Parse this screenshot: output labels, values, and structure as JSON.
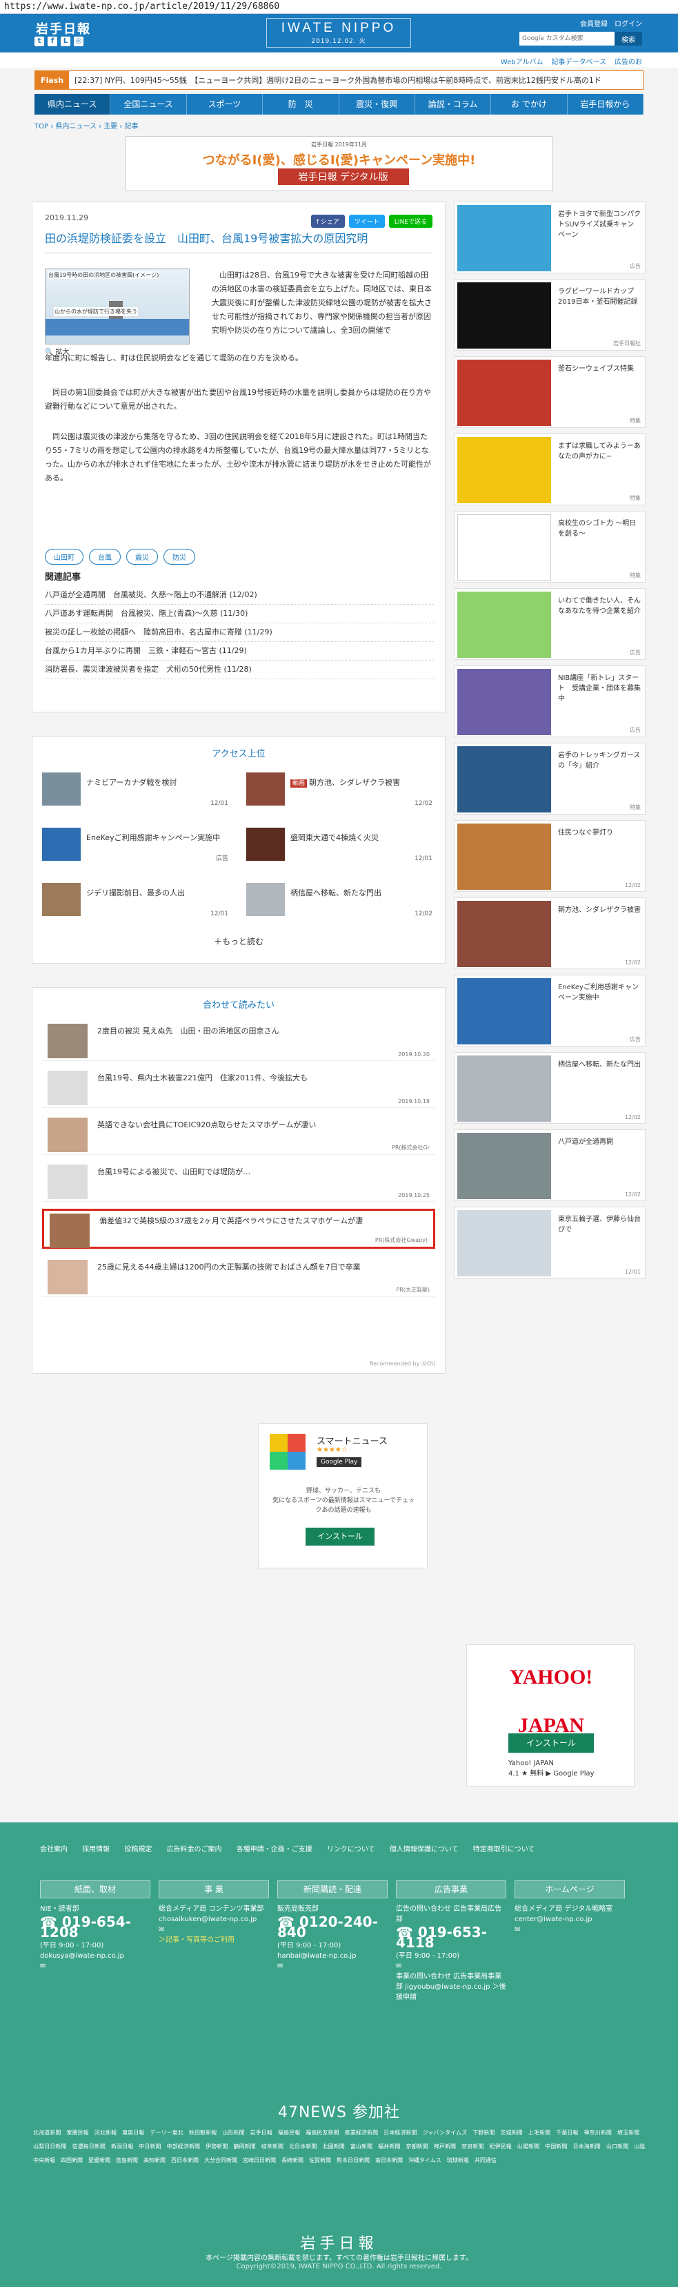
{
  "url": "https://www.iwate-np.co.jp/article/2019/11/29/68860",
  "header": {
    "logo_left": "岩手日報",
    "social_icons": [
      "twitter-icon",
      "facebook-icon",
      "line-icon",
      "instagram-icon"
    ],
    "center_logo": "IWATE NIPPO",
    "date": "2019.12.02. 火",
    "links": [
      "会員登録",
      "ログイン"
    ],
    "search_placeholder": "Google カスタム検索",
    "search_button": "検索"
  },
  "utility_links": [
    "Webアルバム",
    "記事データベース",
    "広告のお"
  ],
  "flash": {
    "label": "Flash",
    "text": "[22:37] NY円、109円45～55銭　【ニューヨーク共同】週明け2日のニューヨーク外国為替市場の円相場は午前8時時点で、前週末比12銭円安ドル高の1ド"
  },
  "nav": [
    "県内ニュース",
    "全国ニュース",
    "スポーツ",
    "防　災",
    "震災・復興",
    "論説・コラム",
    "お でかけ",
    "岩手日報から"
  ],
  "breadcrumb": "TOP › 県内ニュース › 主要 › 記事",
  "banner": {
    "small": "岩手日報 2019年11月",
    "main": "つながるI(愛)、感じるI(愛)キャンペーン実施中!",
    "logo": "岩手日報 デジタル版"
  },
  "article": {
    "date": "2019.11.29",
    "share": [
      "f シェア",
      "ツイート",
      "LINEで送る"
    ],
    "title": "田の浜堤防検証委を設立　山田町、台風19号被害拡大の原因究明",
    "image_caption": "台風19号時の田の浜地区の被害図(イメージ)",
    "image_label": "山からの水が堤防で行き場を失う",
    "zoom": "🔍 拡大",
    "p1": "山田町は28日、台風19号で大きな被害を受けた同町船越の田の浜地区の水害の検証委員会を立ち上げた。同地区では、東日本大震災後に町が整備した津波防災緑地公園の堤防が被害を拡大させた可能性が指摘されており、専門家や関係機関の担当者が原因究明や防災の在り方について議論し、全3回の開催で",
    "p1b": "年度内に町に報告し、町は住民説明会などを通じて堤防の在り方を決める。",
    "p2": "同日の第1回委員会では町が大きな被害が出た要因や台風19号接近時の水量を説明し委員からは堤防の在り方や避難行動などについて意見が出された。",
    "p3": "同公園は震災後の津波から集落を守るため、3回の住民説明会を経て2018年5月に建設された。町は1時間当たり55・7ミリの雨を想定して公園内の排水路を4カ所整備していたが、台風19号の最大降水量は同77・5ミリとなった。山からの水が排水されず住宅地にたまったが、土砂や流木が排水管に詰まり堤防が水をせき止めた可能性がある。",
    "tags": [
      "山田町",
      "台風",
      "震災",
      "防災"
    ],
    "related_heading": "関連記事",
    "related": [
      "八戸道が全通再開　台風被災、久慈～階上の不通解消 (12/02)",
      "八戸道あす運転再開　台風被災、階上(青森)～久慈 (11/30)",
      "被災の証し一枚絵の掲額へ　陸前高田市、名古屋市に寄贈 (11/29)",
      "台風から1カ月半ぶりに再開　三鉄・津軽石～宮古 (11/29)",
      "消防署長、震災津波被災者を指定　犬桁の50代男性 (11/28)"
    ]
  },
  "access": {
    "heading": "アクセス上位",
    "items": [
      {
        "text": "ナミビアーカナダ戦を検討",
        "date": "12/01",
        "badge": ""
      },
      {
        "text": "朝方池、シダレザクラ被害",
        "date": "12/02",
        "badge": "動画"
      },
      {
        "text": "EneKeyご利用感謝キャンペーン実施中",
        "date": "広告",
        "badge": ""
      },
      {
        "text": "盛岡東大通で4棟焼く火災",
        "date": "12/01",
        "badge": ""
      },
      {
        "text": "ジデリ撮影前日、最多の人出",
        "date": "12/01",
        "badge": ""
      },
      {
        "text": "柄信屋へ移転、新たな門出",
        "date": "12/02",
        "badge": ""
      }
    ],
    "more": "＋もっと読む"
  },
  "together": {
    "heading": "合わせて読みたい",
    "items": [
      {
        "text": "2度目の被災 見えぬ先　山田・田の浜地区の田京さん",
        "sub": "2019.10.20"
      },
      {
        "text": "台風19号、県内土木被害221億円　住家2011件、今後拡大も",
        "sub": "2019.10.18"
      },
      {
        "text": "英語できない会社員にTOEIC920点取らせたスマホゲームが凄い",
        "sub": "PR(株式会社Gr"
      },
      {
        "text": "台風19号による被災で、山田町では堤防が…",
        "sub": "2019.10.25"
      },
      {
        "text": "偏差値32で英検5級の37歳を2ヶ月で英語ペラペラにさせたスマホゲームが凄",
        "sub": "PR(株式会社Gwapy)"
      },
      {
        "text": "25歳に見える44歳主婦は1200円の大正製薬の技術でおばさん顔を7日で卒業",
        "sub": "PR(大正製薬)"
      }
    ],
    "recommended": "Recommended by ⓊOU"
  },
  "smart_news": {
    "name": "スマートニュース",
    "stars": "★★★★☆",
    "store": "Google Play",
    "desc1": "野球、サッカー、テニスも",
    "desc2": "気になるスポーツの最新情報はスマニューでチェックあの話題の速報も",
    "install": "インストール"
  },
  "sidebar": [
    {
      "text": "岩手トヨタで新型コンパクトSUVライズ試乗キャンペーン",
      "sponsor": "広告"
    },
    {
      "text": "ラグビーワールドカップ2019日本・釜石開催記録",
      "sponsor": "岩手日報社"
    },
    {
      "text": "釜石シーウェイブス特集",
      "sponsor": "特集"
    },
    {
      "text": "まずは求職してみようーあなたの声がカに−",
      "sponsor": "特集"
    },
    {
      "text": "高校生のシゴト力 ～明日を創る～",
      "sponsor": "特集"
    },
    {
      "text": "いわてで働きたい人、そんなあなたを待つ企業を紹介",
      "sponsor": "広告"
    },
    {
      "text": "NIB講座「新トレ」スタート　受講企業・団体を募集中",
      "sponsor": "広告"
    },
    {
      "text": "岩手のトレッキングガースの「今」紹介",
      "sponsor": "特集"
    },
    {
      "text": "住民つなぐ夢灯り",
      "sponsor": "12/02"
    },
    {
      "text": "朝方池、シダレザクラ被害",
      "sponsor": "12/02"
    },
    {
      "text": "EneKeyご利用感謝キャンペーン実施中",
      "sponsor": "広告"
    },
    {
      "text": "柄信屋へ移転、新たな門出",
      "sponsor": "12/02"
    },
    {
      "text": "八戸道が全通再開",
      "sponsor": "12/02"
    },
    {
      "text": "東京五輪子選、伊藤ら仙台びで",
      "sponsor": "12/01"
    }
  ],
  "yahoo": {
    "logo": "YAHOO! JAPAN",
    "install": "インストール",
    "name": "Yahoo! JAPAN",
    "rating": "4.1 ★ 無料 ▶ Google Play"
  },
  "footer": {
    "links": [
      "会社案内",
      "採用情報",
      "投稿規定",
      "広告料金のご案内",
      "各種申請・企画・ご支援",
      "リンクについて",
      "個人情報保護について",
      "特定商取引について"
    ],
    "cols": [
      {
        "h": "紙面、取材",
        "l1": "NIE・読者部",
        "ph": "019-654-1208",
        "l2": "(平日 9:00 - 17:00)",
        "l3": "dokusya@iwate-np.co.jp"
      },
      {
        "h": "事 業",
        "l1": "総合メディア局 コンテンツ事業部",
        "ph": "",
        "l2": "chosaikuken@iwate-np.co.jp",
        "l3": "＞記事・写真等のご利用"
      },
      {
        "h": "新聞購読・配達",
        "l1": "販売局販売部",
        "ph": "0120-240-840",
        "l2": "(平日 9:00 - 17:00)",
        "l3": "hanbai@iwate-np.co.jp"
      },
      {
        "h": "広告事業",
        "l1": "広告の問い合わせ 広告事業局広告部",
        "ph": "019-653-4118",
        "l2": "(平日 9:00 - 17:00)",
        "l3": "事業の問い合わせ 広告事業局事業部 jigyoubu@iwate-np.co.jp ＞後援申請"
      },
      {
        "h": "ホームページ",
        "l1": "総合メディア局 デジタル戦略室",
        "ph": "",
        "l2": "center@iwate-np.co.jp",
        "l3": ""
      }
    ],
    "news47": "47NEWS 参加社",
    "papers": [
      "北海道新聞",
      "室蘭民報",
      "河北新報",
      "東奥日報",
      "デーリー東北",
      "秋田魁新報",
      "山形新聞",
      "岩手日報",
      "福島民報",
      "福島民友新聞",
      "産業経済新聞",
      "日本経済新聞",
      "ジャパンタイムズ",
      "下野新聞",
      "茨城新聞",
      "上毛新聞",
      "千葉日報",
      "神奈川新聞",
      "埼玉新聞",
      "山梨日日新聞",
      "信濃毎日新聞",
      "新潟日報",
      "中日新聞",
      "中部経済新聞",
      "伊勢新聞",
      "静岡新聞",
      "岐阜新聞",
      "北日本新聞",
      "北國新聞",
      "富山新聞",
      "福井新聞",
      "京都新聞",
      "神戸新聞",
      "奈良新聞",
      "紀伊民報",
      "山陽新聞",
      "中国新聞",
      "日本海新聞",
      "山口新聞",
      "山陰中央新報",
      "四国新聞",
      "愛媛新聞",
      "徳島新聞",
      "高知新聞",
      "西日本新聞",
      "大分合同新聞",
      "宮崎日日新聞",
      "長崎新聞",
      "佐賀新聞",
      "熊本日日新聞",
      "南日本新聞",
      "沖縄タイムス",
      "琉球新報",
      "共同通信"
    ],
    "logo": "岩手日報",
    "copy1": "本ページ掲載内容の無断転載を禁じます。すべての著作権は岩手日報社に帰属します。",
    "copy2": "Copyright©2019, IWATE NIPPO CO.,LTD. All rights reserved."
  }
}
